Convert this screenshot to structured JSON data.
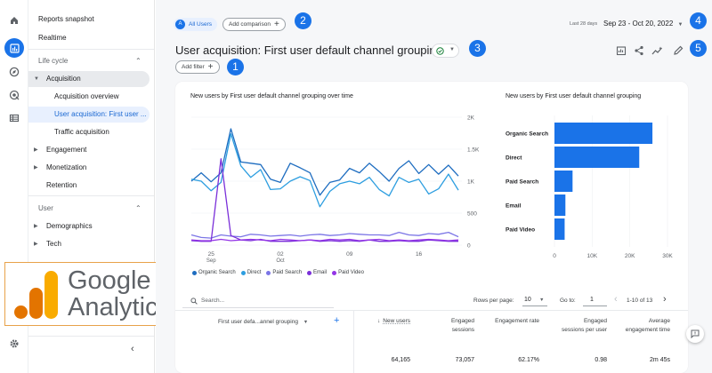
{
  "sidebar": {
    "items": [
      {
        "label": "Reports snapshot"
      },
      {
        "label": "Realtime"
      },
      {
        "label": "Life cycle"
      },
      {
        "label": "Acquisition"
      },
      {
        "label": "Acquisition overview"
      },
      {
        "label": "User acquisition: First user ..."
      },
      {
        "label": "Traffic acquisition"
      },
      {
        "label": "Engagement"
      },
      {
        "label": "Monetization"
      },
      {
        "label": "Retention"
      },
      {
        "label": "User"
      },
      {
        "label": "Demographics"
      },
      {
        "label": "Tech"
      }
    ]
  },
  "logo": {
    "line1": "Google",
    "line2": "Analytics",
    "brand_colors": [
      "#f9ab00",
      "#e37400"
    ]
  },
  "topbar": {
    "segment_badge": "A",
    "segment_label": "All Users",
    "add_comparison": "Add comparison",
    "date_caption": "Last 28 days",
    "date_range": "Sep 23 - Oct 20, 2022"
  },
  "report": {
    "title": "User acquisition: First user default channel grouping",
    "add_filter": "Add filter"
  },
  "callouts": [
    "1",
    "2",
    "3",
    "4",
    "5"
  ],
  "line_chart": {
    "title": "New users by First user default channel grouping over time",
    "yticks": [
      "2K",
      "1.5K",
      "1K",
      "500",
      "0"
    ],
    "xticks": [
      {
        "day": "25",
        "month": "Sep"
      },
      {
        "day": "02",
        "month": "Oct"
      },
      {
        "day": "09",
        "month": ""
      },
      {
        "day": "16",
        "month": ""
      }
    ]
  },
  "bar_chart": {
    "title": "New users by First user default channel grouping",
    "xticks": [
      "0",
      "10K",
      "20K",
      "30K"
    ]
  },
  "chart_data": [
    {
      "type": "line",
      "title": "New users by First user default channel grouping over time",
      "x": [
        "Sep 23",
        "Sep 24",
        "Sep 25",
        "Sep 26",
        "Sep 27",
        "Sep 28",
        "Sep 29",
        "Sep 30",
        "Oct 01",
        "Oct 02",
        "Oct 03",
        "Oct 04",
        "Oct 05",
        "Oct 06",
        "Oct 07",
        "Oct 08",
        "Oct 09",
        "Oct 10",
        "Oct 11",
        "Oct 12",
        "Oct 13",
        "Oct 14",
        "Oct 15",
        "Oct 16",
        "Oct 17",
        "Oct 18",
        "Oct 19",
        "Oct 20"
      ],
      "ylim": [
        0,
        2000
      ],
      "series": [
        {
          "name": "Organic Search",
          "color": "#1e6dc0",
          "values": [
            1000,
            1130,
            990,
            1130,
            1820,
            1300,
            1280,
            1260,
            1030,
            980,
            1280,
            1210,
            1130,
            780,
            980,
            1020,
            1200,
            1130,
            1280,
            1150,
            1000,
            1200,
            1320,
            1120,
            1260,
            1110,
            1250,
            1080
          ]
        },
        {
          "name": "Direct",
          "color": "#2d9ee0",
          "values": [
            1030,
            1000,
            850,
            980,
            1740,
            1240,
            1060,
            1180,
            870,
            880,
            1000,
            1070,
            1010,
            600,
            840,
            960,
            1000,
            960,
            1060,
            870,
            770,
            1060,
            980,
            1030,
            800,
            880,
            1110,
            860
          ]
        },
        {
          "name": "Paid Search",
          "color": "#7b75e6",
          "values": [
            160,
            120,
            110,
            160,
            140,
            130,
            170,
            160,
            140,
            150,
            160,
            140,
            160,
            170,
            150,
            160,
            180,
            170,
            160,
            160,
            150,
            200,
            160,
            150,
            180,
            170,
            200,
            130
          ]
        },
        {
          "name": "Email",
          "color": "#7a2fd9",
          "values": [
            70,
            60,
            60,
            1350,
            150,
            80,
            70,
            90,
            60,
            60,
            60,
            70,
            80,
            60,
            70,
            60,
            70,
            60,
            80,
            60,
            60,
            70,
            60,
            60,
            80,
            70,
            60,
            60
          ]
        },
        {
          "name": "Paid Video",
          "color": "#9334e6",
          "values": [
            80,
            70,
            70,
            90,
            70,
            80,
            90,
            80,
            70,
            90,
            80,
            70,
            80,
            70,
            90,
            80,
            90,
            70,
            80,
            90,
            70,
            80,
            70,
            80,
            90,
            80,
            70,
            80
          ]
        }
      ]
    },
    {
      "type": "bar",
      "title": "New users by First user default channel grouping",
      "categories": [
        "Organic Search",
        "Direct",
        "Paid Search",
        "Email",
        "Paid Video"
      ],
      "values": [
        26000,
        22500,
        4800,
        2900,
        2700
      ],
      "xlim": [
        0,
        30000
      ],
      "color": "#1a73e8"
    }
  ],
  "table": {
    "search_placeholder": "Search...",
    "rows_per_page_label": "Rows per page:",
    "rows_per_page_value": "10",
    "goto_label": "Go to:",
    "goto_value": "1",
    "range_text": "1-10 of 13",
    "dimension_header": "First user defa...annel grouping",
    "sort_arrow": "↓",
    "columns": [
      {
        "label": "New users",
        "total": "64,165"
      },
      {
        "label": "Engaged sessions",
        "total": "73,057"
      },
      {
        "label": "Engagement rate",
        "total": "62.17%"
      },
      {
        "label": "Engaged sessions per user",
        "total": "0.98"
      },
      {
        "label": "Average engagement time",
        "total": "2m 45s"
      }
    ]
  }
}
